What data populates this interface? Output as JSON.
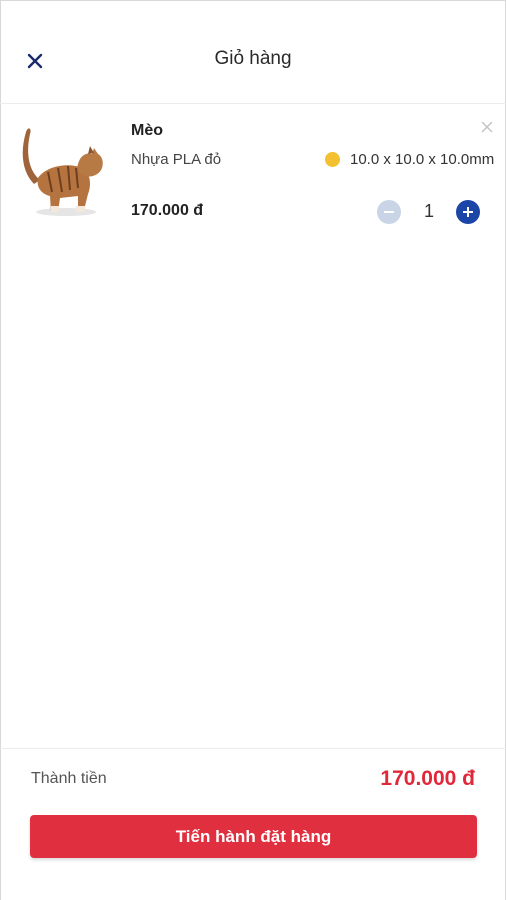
{
  "header": {
    "title": "Giỏ hàng",
    "close_icon": "close-icon"
  },
  "cart": {
    "items": [
      {
        "name": "Mèo",
        "material": "Nhựa PLA đỏ",
        "color": "#f2c030",
        "size": "10.0 x 10.0 x 10.0mm",
        "price": "170.000 đ",
        "quantity": "1",
        "thumbnail_icon": "cat-model-image",
        "remove_icon": "close-icon",
        "minus_icon": "minus-icon",
        "plus_icon": "plus-icon"
      }
    ]
  },
  "footer": {
    "total_label": "Thành tiền",
    "total_value": "170.000 đ",
    "checkout_label": "Tiến hành đặt hàng"
  },
  "colors": {
    "accent": "#e03040",
    "primary": "#1b46a8",
    "price_red": "#e0283a"
  }
}
